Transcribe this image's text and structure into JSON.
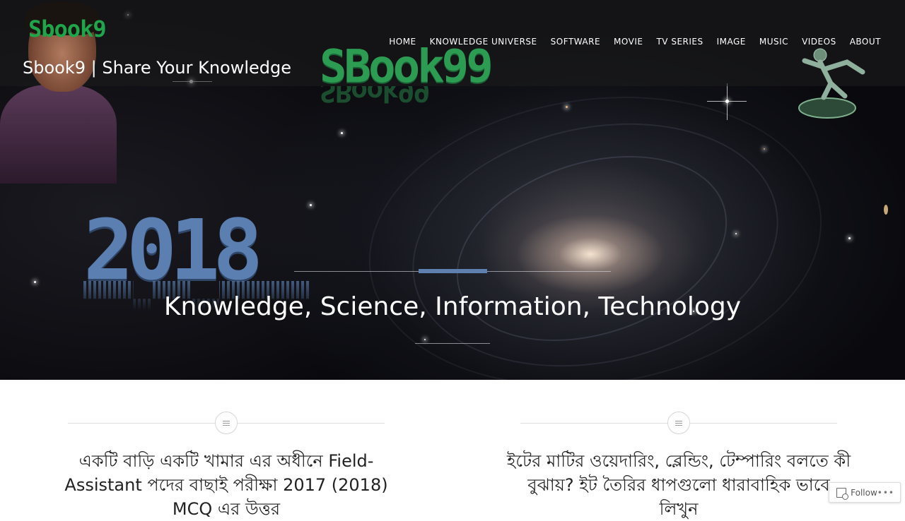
{
  "site": {
    "logo_text": "Sbook9",
    "tagline": "Sbook9 | Share Your Knowledge"
  },
  "nav": {
    "items": [
      {
        "label": "HOME"
      },
      {
        "label": "KNOWLEDGE UNIVERSE"
      },
      {
        "label": "SOFTWARE"
      },
      {
        "label": "MOVIE"
      },
      {
        "label": "TV SERIES"
      },
      {
        "label": "IMAGE"
      },
      {
        "label": "MUSIC"
      },
      {
        "label": "VIDEOS"
      },
      {
        "label": "ABOUT"
      }
    ]
  },
  "hero": {
    "brand": "SBook99",
    "year": "2018",
    "heading": "Knowledge, Science, Information, Technology"
  },
  "posts": [
    {
      "title": "একটি বাড়ি একটি খামার এর অধীনে Field-Assistant পদের বাছাই পরীক্ষা 2017 (2018) MCQ এর উত্তর"
    },
    {
      "title": "ইটের মাটির ওয়েদারিং, ব্লেন্ডিং, টেম্পারিং বলতে কী বুঝায়? ইট তৈরির ধাপগুলো ধারাবাহিক ভাবে লিখুন"
    }
  ],
  "follow": {
    "label": "Follow",
    "more": "•••"
  },
  "colors": {
    "logo_green": "#1fa64a",
    "accent_blue": "#5f7fae"
  }
}
